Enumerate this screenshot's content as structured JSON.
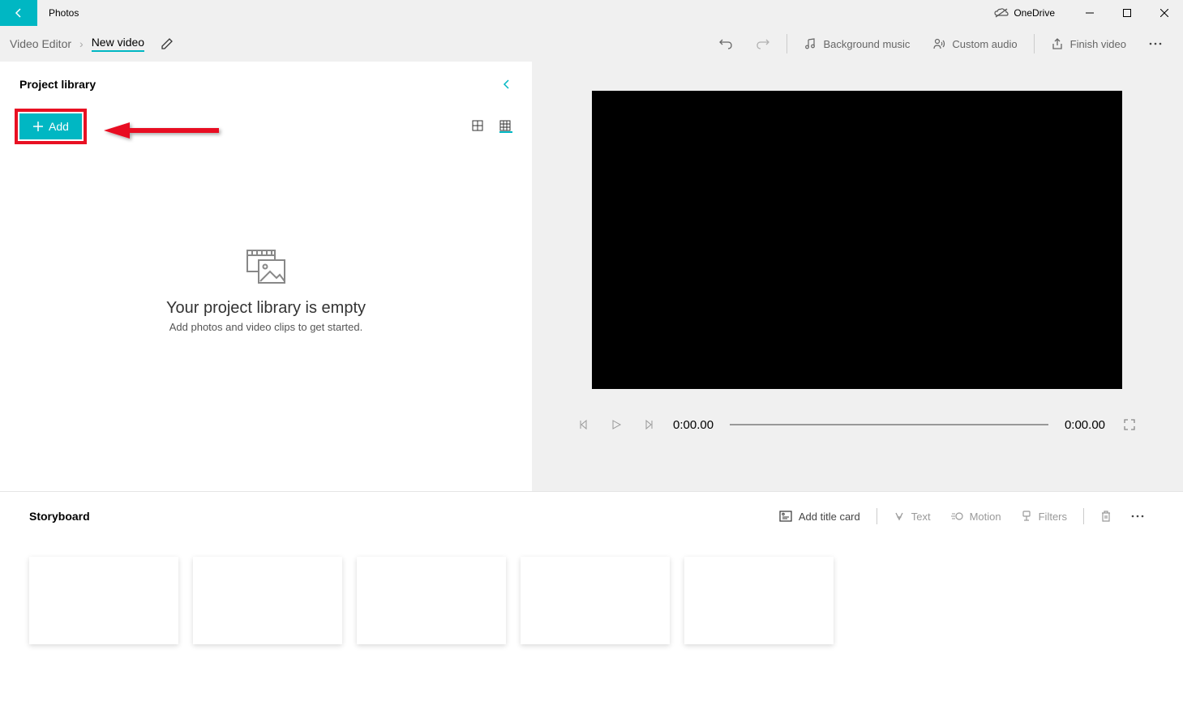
{
  "app": {
    "title": "Photos"
  },
  "titlebar": {
    "onedrive": "OneDrive"
  },
  "breadcrumb": {
    "root": "Video Editor",
    "current": "New video"
  },
  "toolbar": {
    "bg_music": "Background music",
    "custom_audio": "Custom audio",
    "finish": "Finish video"
  },
  "library": {
    "title": "Project library",
    "add": "Add",
    "empty_title": "Your project library is empty",
    "empty_sub": "Add photos and video clips to get started."
  },
  "playback": {
    "current": "0:00.00",
    "total": "0:00.00"
  },
  "storyboard": {
    "title": "Storyboard",
    "add_title_card": "Add title card",
    "text": "Text",
    "motion": "Motion",
    "filters": "Filters"
  }
}
